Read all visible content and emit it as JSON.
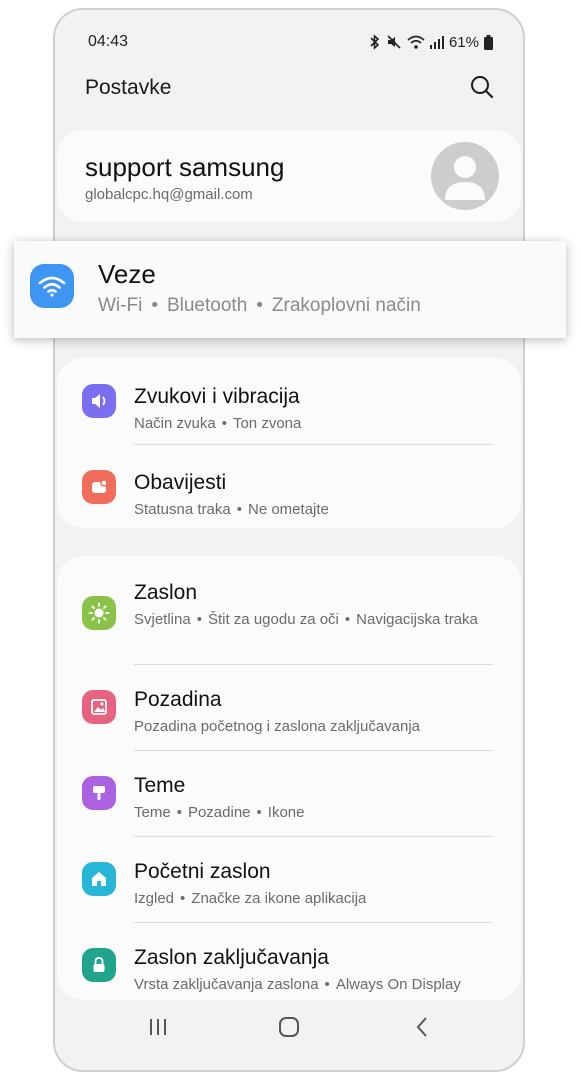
{
  "status_bar": {
    "time": "04:43",
    "battery": "61%"
  },
  "header": {
    "title": "Postavke"
  },
  "profile": {
    "name": "support samsung",
    "email": "globalcpc.hq@gmail.com"
  },
  "connections": {
    "title": "Veze",
    "sub": [
      "Wi-Fi",
      "Bluetooth",
      "Zrakoplovni način"
    ],
    "icon": "wifi-icon",
    "color": "#3f95f2"
  },
  "group1": [
    {
      "title": "Zvukovi i vibracija",
      "sub": [
        "Način zvuka",
        "Ton zvona"
      ],
      "icon": "volume-icon",
      "color": "#7b6ef0"
    },
    {
      "title": "Obavijesti",
      "sub": [
        "Statusna traka",
        "Ne ometajte"
      ],
      "icon": "notification-icon",
      "color": "#f06d5c"
    }
  ],
  "group2": [
    {
      "title": "Zaslon",
      "sub": [
        "Svjetlina",
        "Štit za ugodu za oči",
        "Navigacijska traka"
      ],
      "icon": "brightness-icon",
      "color": "#8bc34a"
    },
    {
      "title": "Pozadina",
      "sub": [
        "Pozadina početnog i zaslona zaključavanja"
      ],
      "icon": "wallpaper-icon",
      "color": "#e8637f"
    },
    {
      "title": "Teme",
      "sub": [
        "Teme",
        "Pozadine",
        "Ikone"
      ],
      "icon": "theme-brush-icon",
      "color": "#ab62e0"
    },
    {
      "title": "Početni zaslon",
      "sub": [
        "Izgled",
        "Značke za ikone aplikacija"
      ],
      "icon": "home-icon",
      "color": "#27b5d8"
    },
    {
      "title": "Zaslon zaključavanja",
      "sub": [
        "Vrsta zaključavanja zaslona",
        "Always On Display"
      ],
      "icon": "lock-icon",
      "color": "#20a58c"
    }
  ]
}
